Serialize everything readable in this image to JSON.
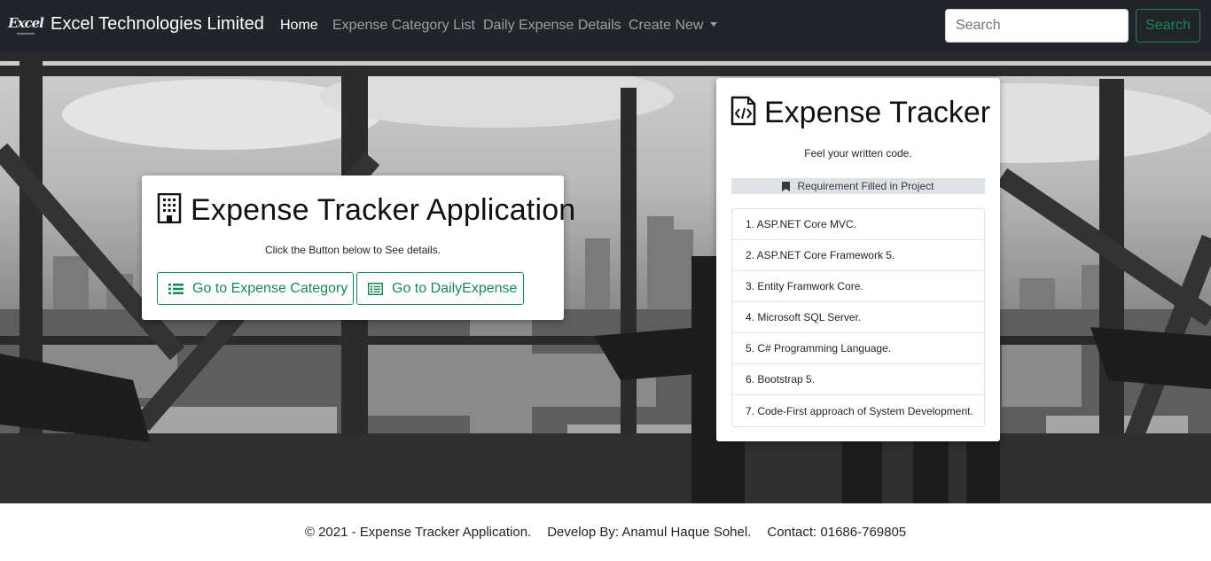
{
  "navbar": {
    "logo_text": "Excel",
    "brand": "Excel Technologies Limited",
    "links": [
      {
        "label": "Home"
      },
      {
        "label": "Expense Category List"
      },
      {
        "label": "Daily Expense Details"
      },
      {
        "label": "Create New"
      }
    ],
    "search_placeholder": "Search",
    "search_button": "Search"
  },
  "left_card": {
    "icon": "building-icon",
    "title": "Expense Tracker Application",
    "subtitle": "Click the Button below to See details.",
    "buttons": [
      {
        "label": "Go to Expense Category",
        "icon": "list-icon"
      },
      {
        "label": "Go to DailyExpense",
        "icon": "card-list-icon"
      }
    ]
  },
  "right_card": {
    "icon": "file-code-icon",
    "title": "Expense Tracker",
    "subtitle": "Feel your written code.",
    "requirement_header": "Requirement Filled in Project",
    "requirements": [
      "1. ASP.NET Core MVC.",
      "2. ASP.NET Core Framework 5.",
      "3. Entity Framwork Core.",
      "4. Microsoft SQL Server.",
      "5. C# Programming Language.",
      "6. Bootstrap 5.",
      "7. Code-First approach of System Development."
    ]
  },
  "footer": {
    "copyright": "© 2021 - Expense Tracker Application.",
    "developer": "Develop By: Anamul Haque Sohel.",
    "contact": "Contact: 01686-769805"
  },
  "colors": {
    "navbar_bg": "#212529",
    "accent_green": "#198754",
    "nav_inactive": "rgba(255,255,255,0.55)"
  }
}
